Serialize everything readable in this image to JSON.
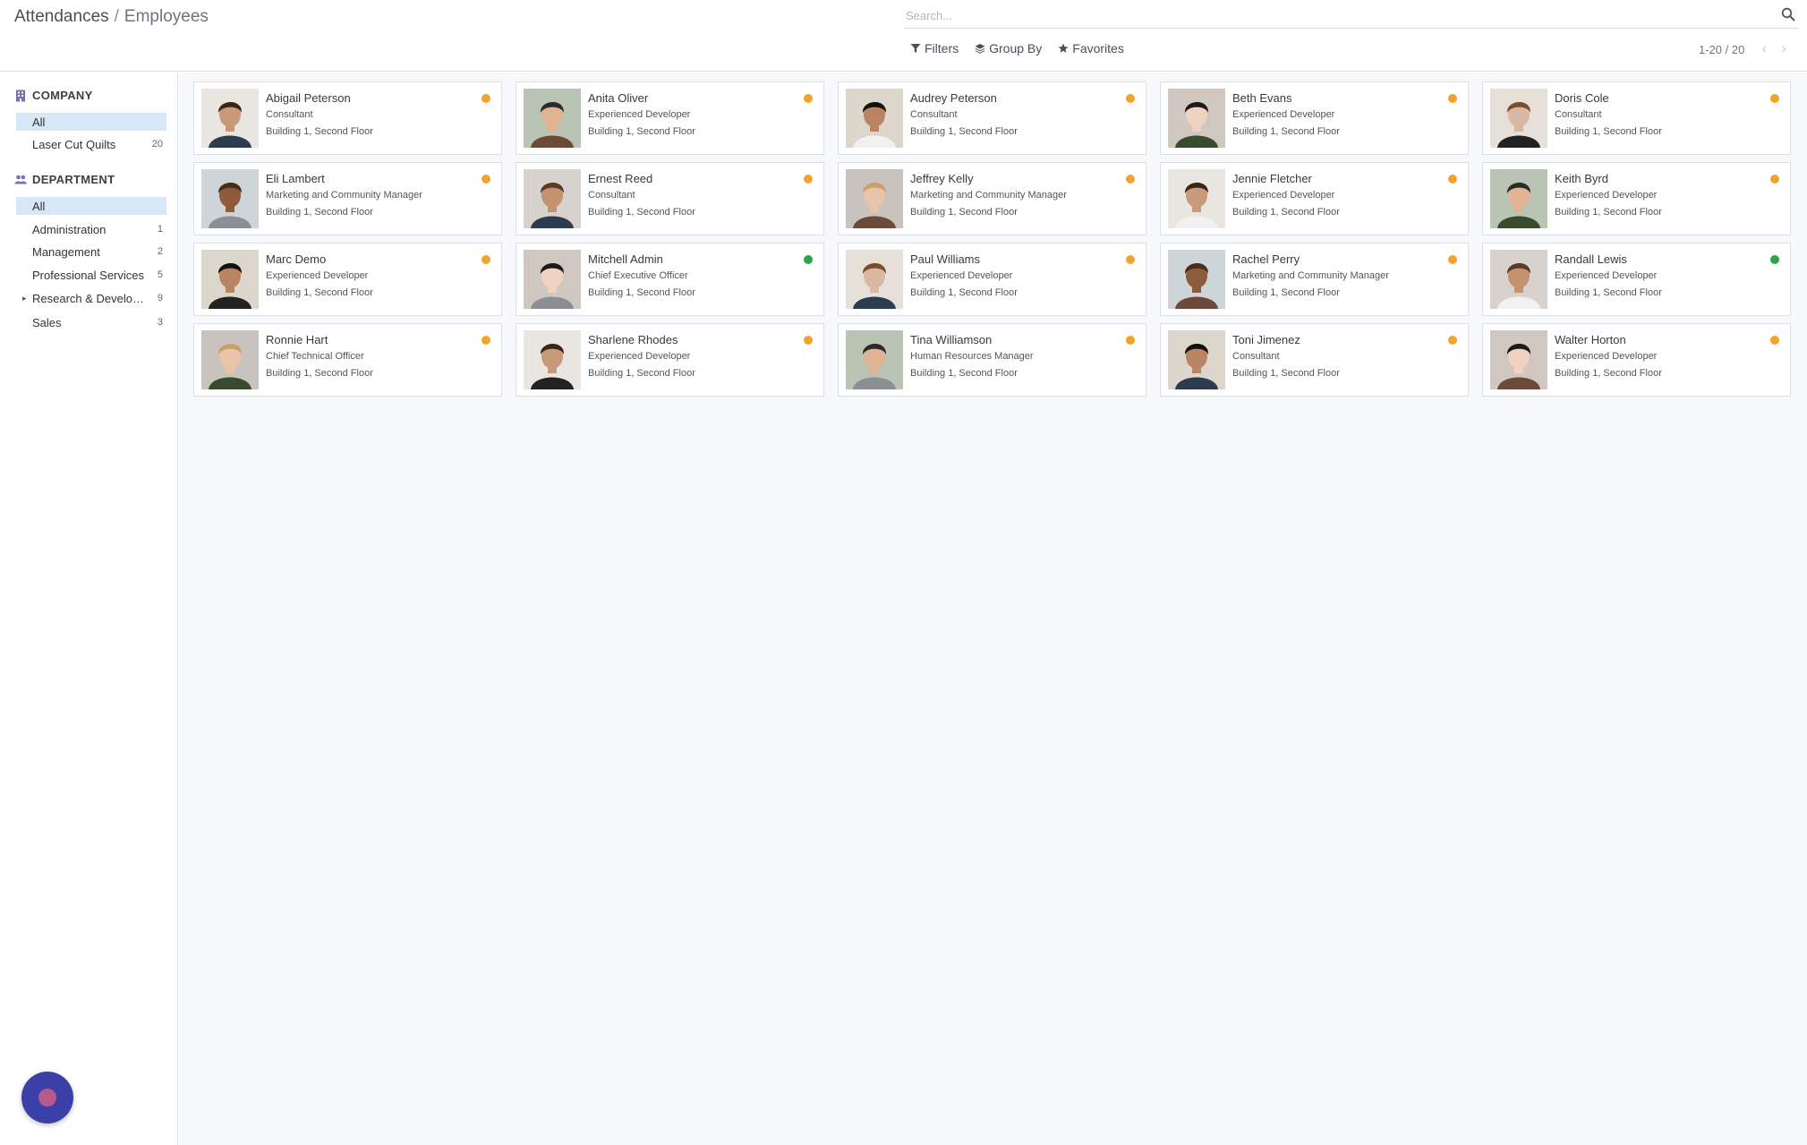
{
  "breadcrumb": {
    "parent": "Attendances",
    "separator": "/",
    "current": "Employees"
  },
  "search": {
    "placeholder": "Search...",
    "icon": "search-icon"
  },
  "search_options": {
    "filters": "Filters",
    "group_by": "Group By",
    "favorites": "Favorites"
  },
  "pager": {
    "value": "1-20 / 20",
    "prev": "‹",
    "next": "›"
  },
  "sidebar": {
    "company": {
      "header": "COMPANY",
      "items": [
        {
          "label": "All",
          "count": "",
          "active": true
        },
        {
          "label": "Laser Cut Quilts",
          "count": "20",
          "active": false
        }
      ]
    },
    "department": {
      "header": "DEPARTMENT",
      "items": [
        {
          "label": "All",
          "count": "",
          "active": true,
          "caret": ""
        },
        {
          "label": "Administration",
          "count": "1",
          "active": false,
          "caret": ""
        },
        {
          "label": "Management",
          "count": "2",
          "active": false,
          "caret": ""
        },
        {
          "label": "Professional Services",
          "count": "5",
          "active": false,
          "caret": ""
        },
        {
          "label": "Research & Develop...",
          "count": "9",
          "active": false,
          "caret": "▸"
        },
        {
          "label": "Sales",
          "count": "3",
          "active": false,
          "caret": ""
        }
      ]
    }
  },
  "colors": {
    "status_away": "#f3a32c",
    "status_present": "#28a745",
    "accent": "#3b3fa8"
  },
  "employees": [
    {
      "name": "Abigail Peterson",
      "job": "Consultant",
      "location": "Building 1, Second Floor",
      "status": "away"
    },
    {
      "name": "Anita Oliver",
      "job": "Experienced Developer",
      "location": "Building 1, Second Floor",
      "status": "away"
    },
    {
      "name": "Audrey Peterson",
      "job": "Consultant",
      "location": "Building 1, Second Floor",
      "status": "away"
    },
    {
      "name": "Beth Evans",
      "job": "Experienced Developer",
      "location": "Building 1, Second Floor",
      "status": "away"
    },
    {
      "name": "Doris Cole",
      "job": "Consultant",
      "location": "Building 1, Second Floor",
      "status": "away"
    },
    {
      "name": "Eli Lambert",
      "job": "Marketing and Community Manager",
      "location": "Building 1, Second Floor",
      "status": "away"
    },
    {
      "name": "Ernest Reed",
      "job": "Consultant",
      "location": "Building 1, Second Floor",
      "status": "away"
    },
    {
      "name": "Jeffrey Kelly",
      "job": "Marketing and Community Manager",
      "location": "Building 1, Second Floor",
      "status": "away"
    },
    {
      "name": "Jennie Fletcher",
      "job": "Experienced Developer",
      "location": "Building 1, Second Floor",
      "status": "away"
    },
    {
      "name": "Keith Byrd",
      "job": "Experienced Developer",
      "location": "Building 1, Second Floor",
      "status": "away"
    },
    {
      "name": "Marc Demo",
      "job": "Experienced Developer",
      "location": "Building 1, Second Floor",
      "status": "away"
    },
    {
      "name": "Mitchell Admin",
      "job": "Chief Executive Officer",
      "location": "Building 1, Second Floor",
      "status": "present"
    },
    {
      "name": "Paul Williams",
      "job": "Experienced Developer",
      "location": "Building 1, Second Floor",
      "status": "away"
    },
    {
      "name": "Rachel Perry",
      "job": "Marketing and Community Manager",
      "location": "Building 1, Second Floor",
      "status": "away"
    },
    {
      "name": "Randall Lewis",
      "job": "Experienced Developer",
      "location": "Building 1, Second Floor",
      "status": "present"
    },
    {
      "name": "Ronnie Hart",
      "job": "Chief Technical Officer",
      "location": "Building 1, Second Floor",
      "status": "away"
    },
    {
      "name": "Sharlene Rhodes",
      "job": "Experienced Developer",
      "location": "Building 1, Second Floor",
      "status": "away"
    },
    {
      "name": "Tina Williamson",
      "job": "Human Resources Manager",
      "location": "Building 1, Second Floor",
      "status": "away"
    },
    {
      "name": "Toni Jimenez",
      "job": "Consultant",
      "location": "Building 1, Second Floor",
      "status": "away"
    },
    {
      "name": "Walter Horton",
      "job": "Experienced Developer",
      "location": "Building 1, Second Floor",
      "status": "away"
    }
  ]
}
